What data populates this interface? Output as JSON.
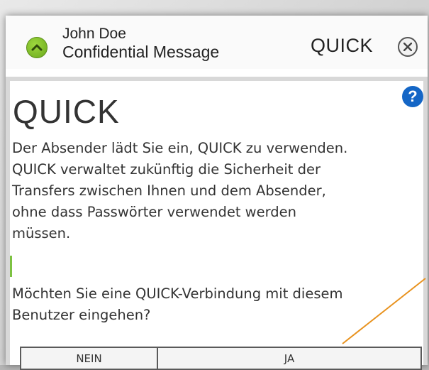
{
  "header": {
    "sender_name": "John Doe",
    "sender_subtitle": "Confidential Message",
    "brand": "QUICK",
    "avatar_icon": "chevron-up-icon",
    "close_icon": "close-icon"
  },
  "content": {
    "brand_title": "QUICK",
    "help_icon": "?",
    "message_lines": [
      "Der Absender lädt Sie ein, QUICK zu verwenden.",
      "QUICK verwaltet zukünftig die Sicherheit der",
      "Transfers zwischen Ihnen und dem Absender,",
      "ohne dass Passwörter verwendet werden",
      "müssen."
    ],
    "question_lines": [
      "Möchten Sie eine QUICK-Verbindung mit diesem",
      "Benutzer eingehen?"
    ]
  },
  "buttons": {
    "no_label": "NEIN",
    "yes_label": "JA"
  },
  "colors": {
    "accent_green": "#7dc242",
    "help_blue": "#1466c6",
    "pointer_orange": "#e8921e"
  }
}
